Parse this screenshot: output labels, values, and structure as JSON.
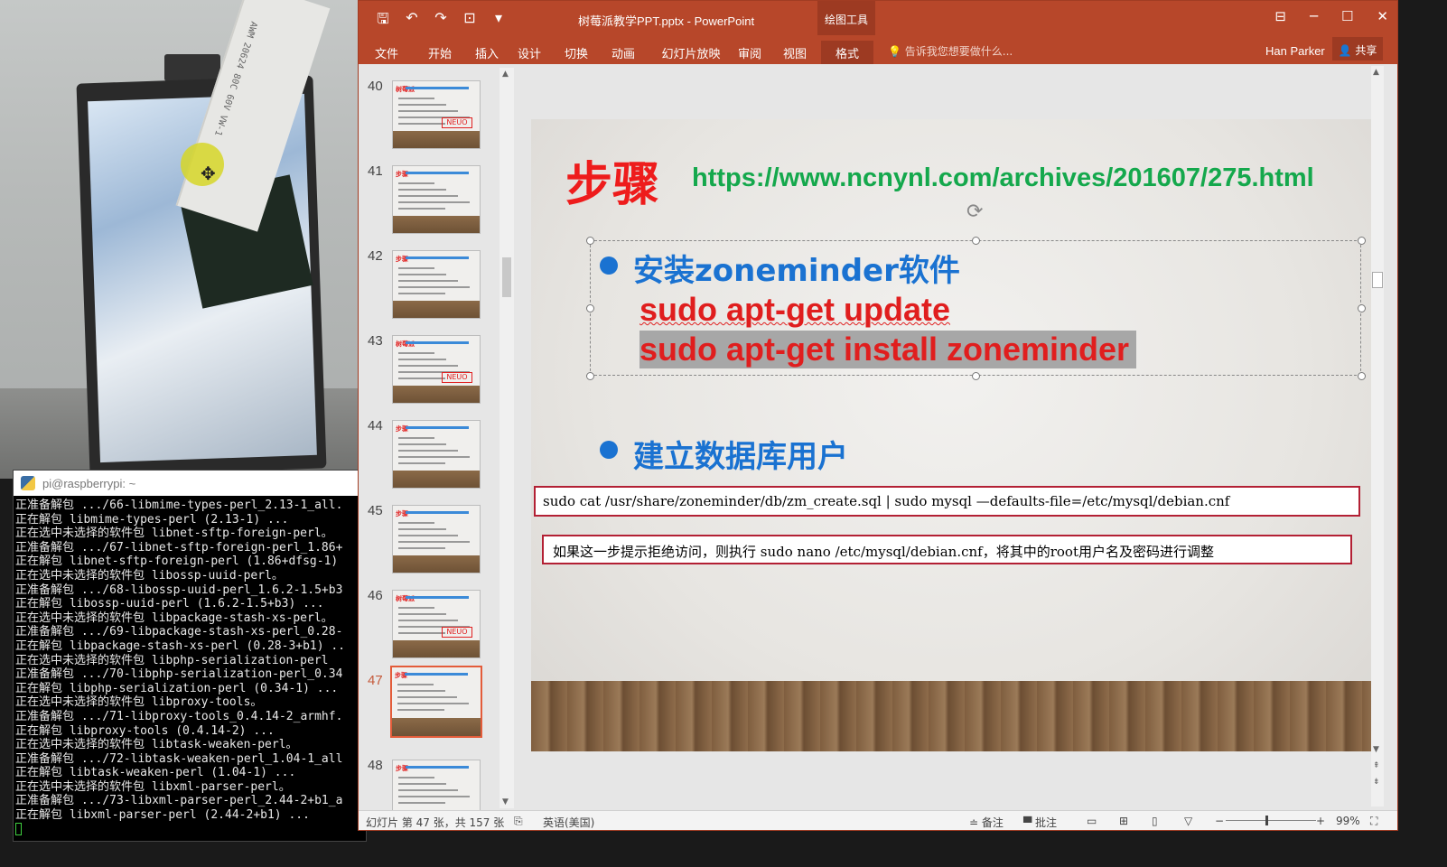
{
  "camera": {
    "ribbon_text": "AWM 20624 80C 60V VW-1"
  },
  "terminal": {
    "title": "pi@raspberrypi: ~",
    "lines": [
      "正准备解包 .../66-libmime-types-perl_2.13-1_all.",
      "正在解包 libmime-types-perl (2.13-1) ...",
      "正在选中未选择的软件包 libnet-sftp-foreign-perl。",
      "正准备解包 .../67-libnet-sftp-foreign-perl_1.86+",
      "正在解包 libnet-sftp-foreign-perl (1.86+dfsg-1)",
      "正在选中未选择的软件包 libossp-uuid-perl。",
      "正准备解包 .../68-libossp-uuid-perl_1.6.2-1.5+b3",
      "正在解包 libossp-uuid-perl (1.6.2-1.5+b3) ...",
      "正在选中未选择的软件包 libpackage-stash-xs-perl。",
      "正准备解包 .../69-libpackage-stash-xs-perl_0.28-",
      "正在解包 libpackage-stash-xs-perl (0.28-3+b1) ..",
      "正在选中未选择的软件包 libphp-serialization-perl",
      "正准备解包 .../70-libphp-serialization-perl_0.34",
      "正在解包 libphp-serialization-perl (0.34-1) ...",
      "正在选中未选择的软件包 libproxy-tools。",
      "正准备解包 .../71-libproxy-tools_0.4.14-2_armhf.",
      "正在解包 libproxy-tools (0.4.14-2) ...",
      "正在选中未选择的软件包 libtask-weaken-perl。",
      "正准备解包 .../72-libtask-weaken-perl_1.04-1_all",
      "正在解包 libtask-weaken-perl (1.04-1) ...",
      "正在选中未选择的软件包 libxml-parser-perl。",
      "正准备解包 .../73-libxml-parser-perl_2.44-2+b1_a",
      "正在解包 libxml-parser-perl (2.44-2+b1) ..."
    ]
  },
  "ppt": {
    "window_title": "树莓派教学PPT.pptx - PowerPoint",
    "context_tab": "绘图工具",
    "tabs": [
      "文件",
      "开始",
      "插入",
      "设计",
      "切换",
      "动画",
      "幻灯片放映",
      "审阅",
      "视图",
      "格式"
    ],
    "tell_me": "告诉我您想要做什么...",
    "user": "Han Parker",
    "share": "共享",
    "thumbnails": [
      {
        "num": "40",
        "red": "树莓派",
        "badge": "NEUO"
      },
      {
        "num": "41",
        "red": "步骤",
        "badge": ""
      },
      {
        "num": "42",
        "red": "步骤",
        "badge": ""
      },
      {
        "num": "43",
        "red": "树莓派",
        "badge": "NEUO"
      },
      {
        "num": "44",
        "red": "步骤",
        "badge": ""
      },
      {
        "num": "45",
        "red": "步骤",
        "badge": ""
      },
      {
        "num": "46",
        "red": "树莓派",
        "badge": "NEUO"
      },
      {
        "num": "47",
        "red": "步骤",
        "badge": ""
      },
      {
        "num": "48",
        "red": "步骤",
        "badge": ""
      }
    ],
    "active_slide": "47",
    "slide": {
      "heading": "步骤",
      "url": "https://www.ncnynl.com/archives/201607/275.html",
      "bullet1": "安装zoneminder软件",
      "cmd1": "sudo apt-get update",
      "cmd2": "sudo apt-get install zoneminder",
      "bullet2": "建立数据库用户",
      "sql": "sudo cat /usr/share/zoneminder/db/zm_create.sql | sudo mysql —defaults-file=/etc/mysql/debian.cnf",
      "note": "如果这一步提示拒绝访问，则执行 sudo nano /etc/mysql/debian.cnf，将其中的root用户名及密码进行调整"
    },
    "status": {
      "slide_info": "幻灯片 第 47 张，共 157 张",
      "language": "英语(美国)",
      "notes": "备注",
      "comments": "批注",
      "zoom": "99%"
    }
  }
}
